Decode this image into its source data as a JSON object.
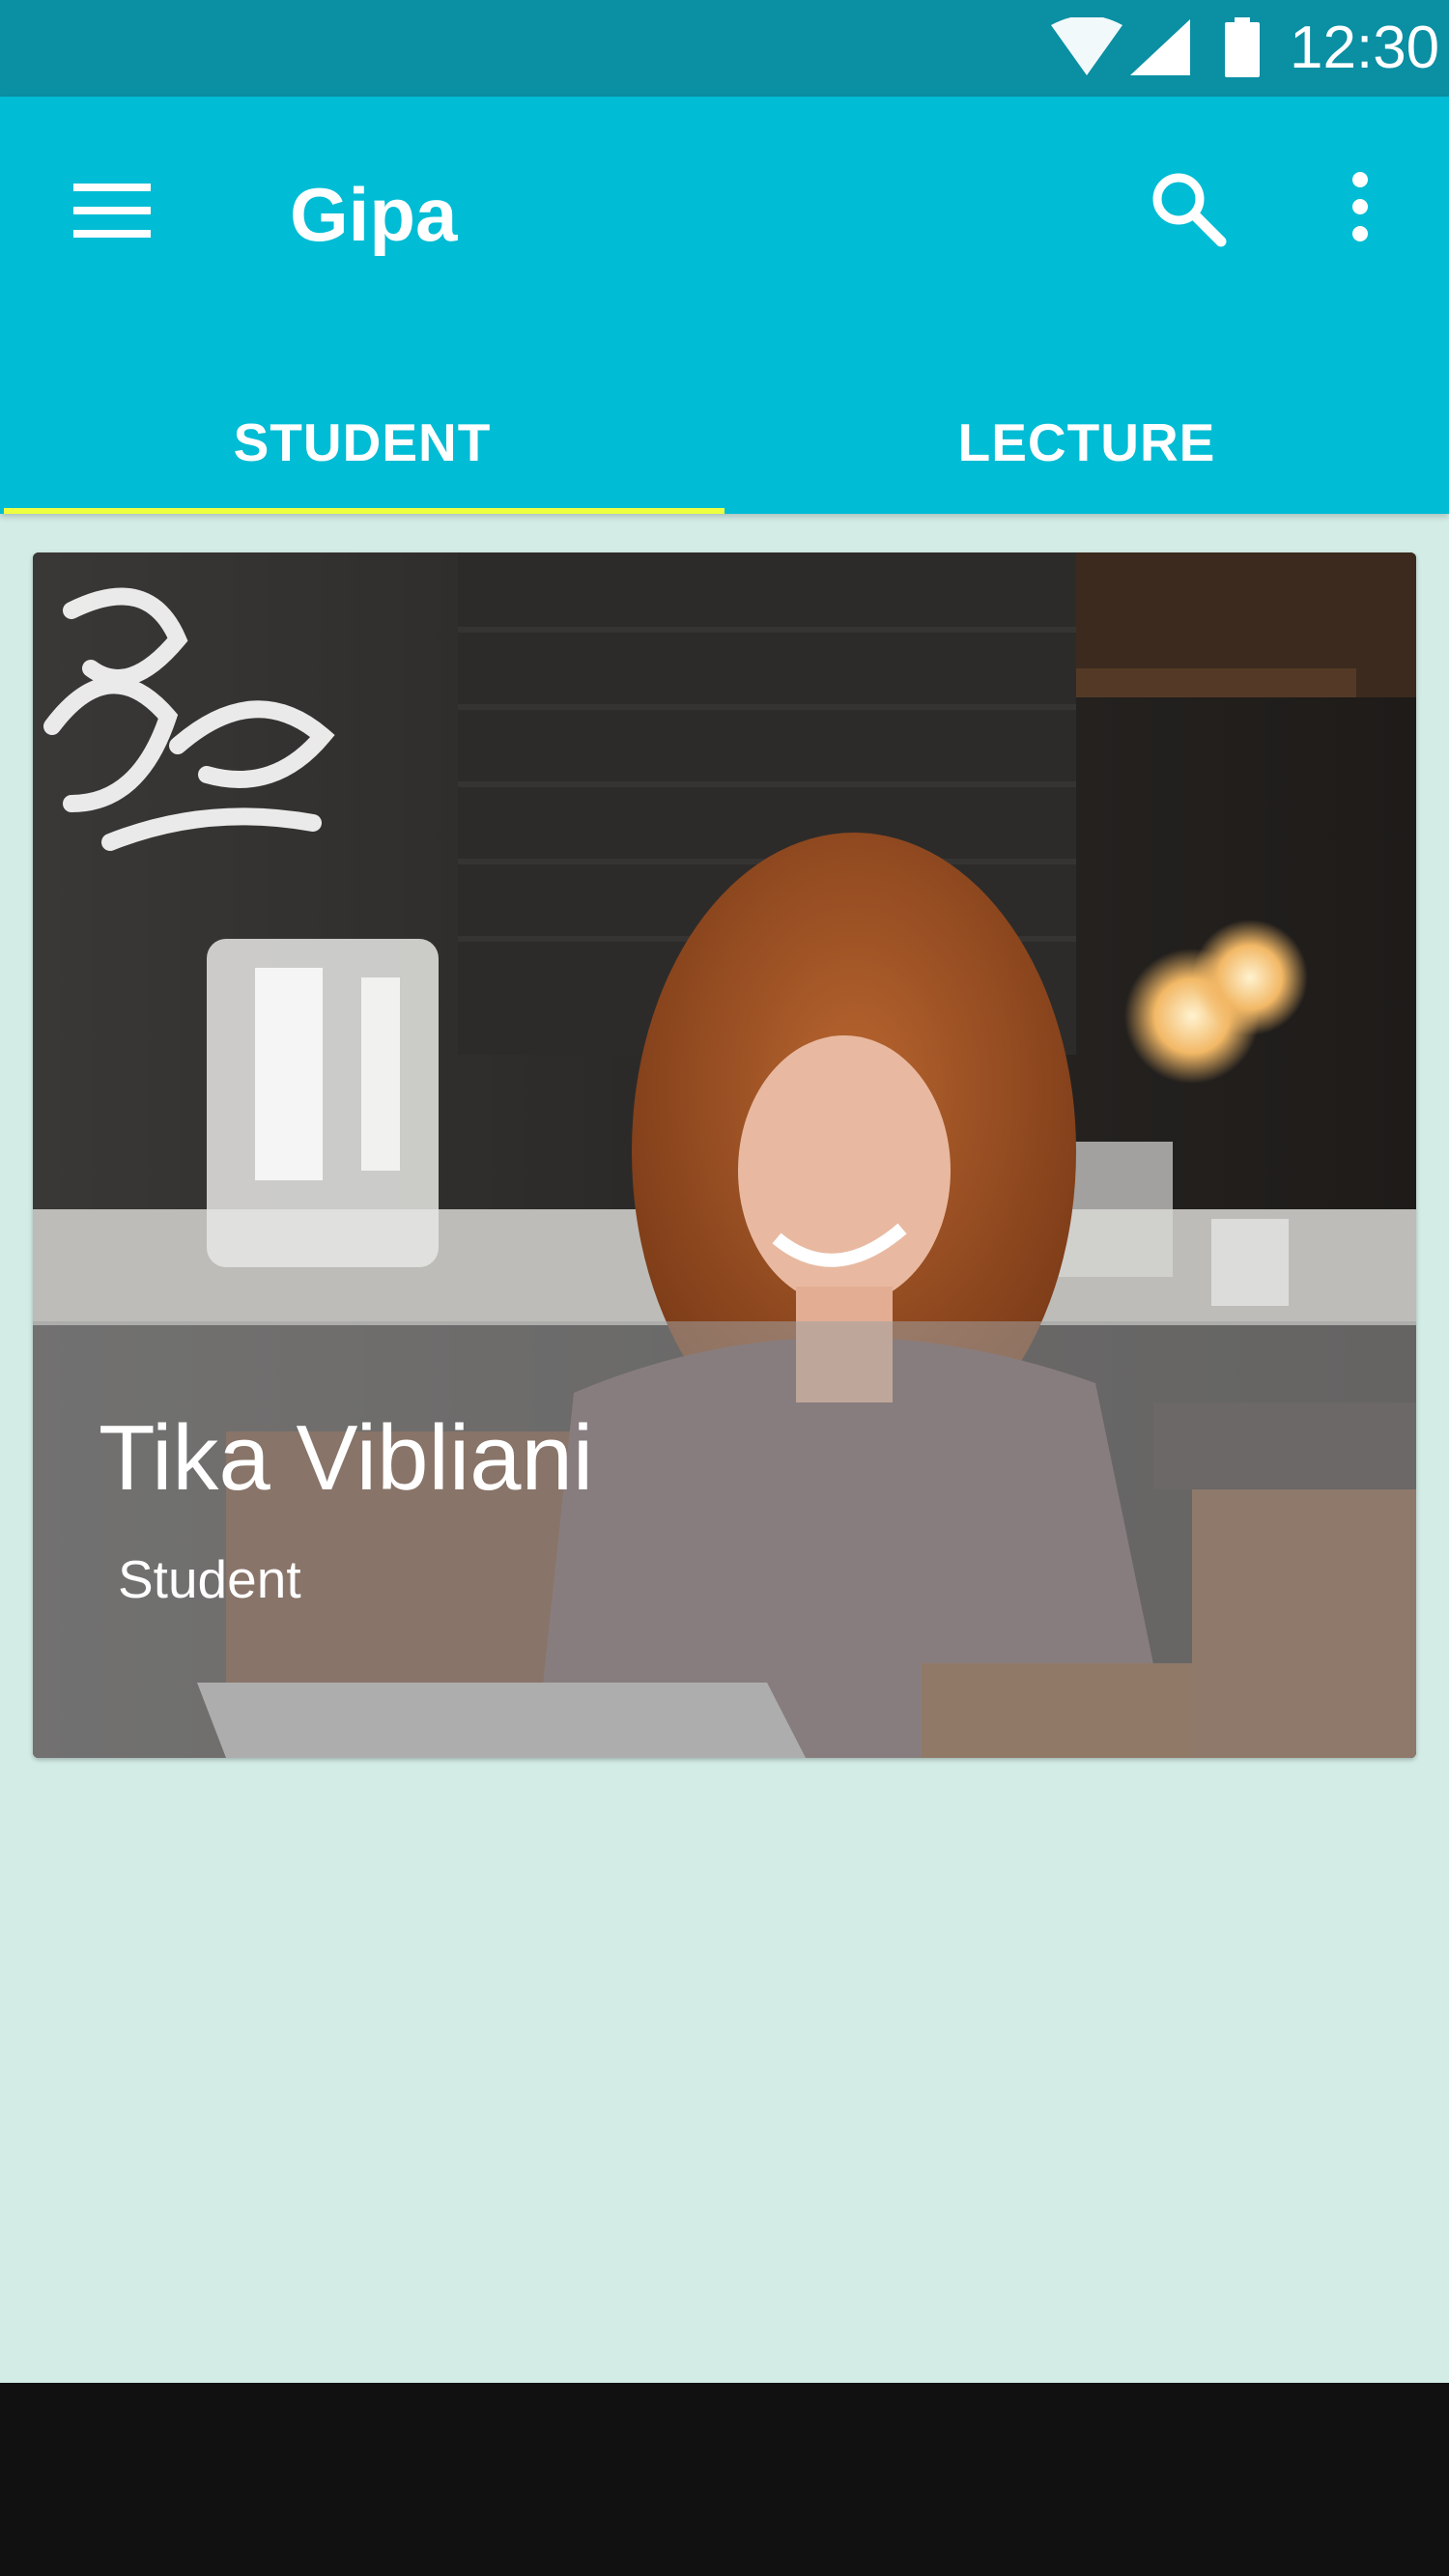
{
  "status_bar": {
    "time": "12:30",
    "icons": [
      "wifi-icon",
      "cell-signal-icon",
      "battery-icon"
    ]
  },
  "app_bar": {
    "title": "Gipa",
    "icons": [
      "menu-icon",
      "search-icon",
      "more-vert-icon"
    ]
  },
  "tabs": [
    {
      "label": "STUDENT",
      "selected": true
    },
    {
      "label": "LECTURE",
      "selected": false
    }
  ],
  "card": {
    "name": "Tika Vibliani",
    "role": "Student"
  },
  "colors": {
    "status_bar": "#0a8fa3",
    "app_bar": "#00bcd4",
    "tab_indicator": "#eeff41",
    "background": "#d3ece6",
    "nav_bar": "#111111"
  }
}
